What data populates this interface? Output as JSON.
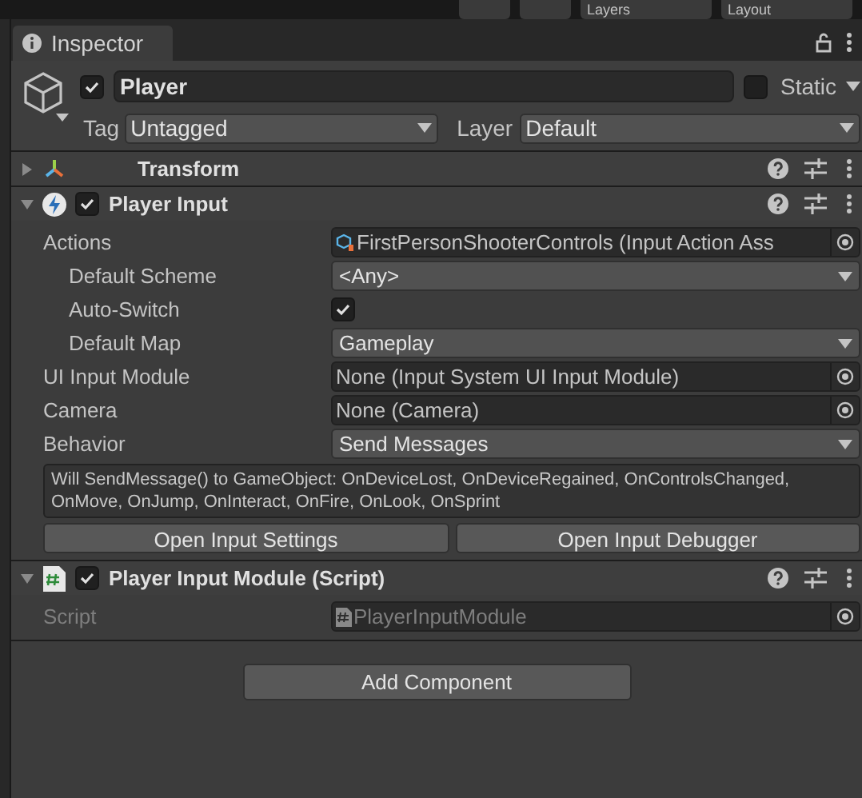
{
  "toolbar": [
    {
      "label": "Layers"
    },
    {
      "label": "Layout"
    }
  ],
  "tab": {
    "title": "Inspector"
  },
  "object": {
    "active": true,
    "name": "Player",
    "static": false,
    "static_label": "Static",
    "tag_label": "Tag",
    "tag": "Untagged",
    "layer_label": "Layer",
    "layer": "Default"
  },
  "components": [
    {
      "title": "Transform",
      "expanded": false
    },
    {
      "title": "Player Input",
      "expanded": true,
      "enabled": true,
      "properties": [
        {
          "label": "Actions",
          "kind": "asset",
          "value": "FirstPersonShooterControls (Input Action Ass",
          "children": [
            {
              "label": "Default Scheme",
              "kind": "dropdown",
              "value": "<Any>"
            },
            {
              "label": "Auto-Switch",
              "kind": "checkbox",
              "checked": true
            },
            {
              "label": "Default Map",
              "kind": "dropdown",
              "value": "Gameplay"
            }
          ]
        },
        {
          "label": "UI Input Module",
          "kind": "object",
          "value": "None (Input System UI Input Module)"
        },
        {
          "label": "Camera",
          "kind": "object",
          "value": "None (Camera)"
        },
        {
          "label": "Behavior",
          "kind": "dropdown",
          "value": "Send Messages"
        }
      ],
      "help_text": "Will SendMessage() to GameObject: OnDeviceLost, OnDeviceRegained, OnControlsChanged, OnMove, OnJump, OnInteract, OnFire, OnLook, OnSprint",
      "buttons": [
        "Open Input Settings",
        "Open Input Debugger"
      ]
    },
    {
      "title": "Player Input Module (Script)",
      "expanded": true,
      "enabled": true,
      "properties": [
        {
          "label": "Script",
          "kind": "script",
          "value": "PlayerInputModule",
          "disabled": true
        }
      ]
    }
  ],
  "add_button": "Add Component"
}
